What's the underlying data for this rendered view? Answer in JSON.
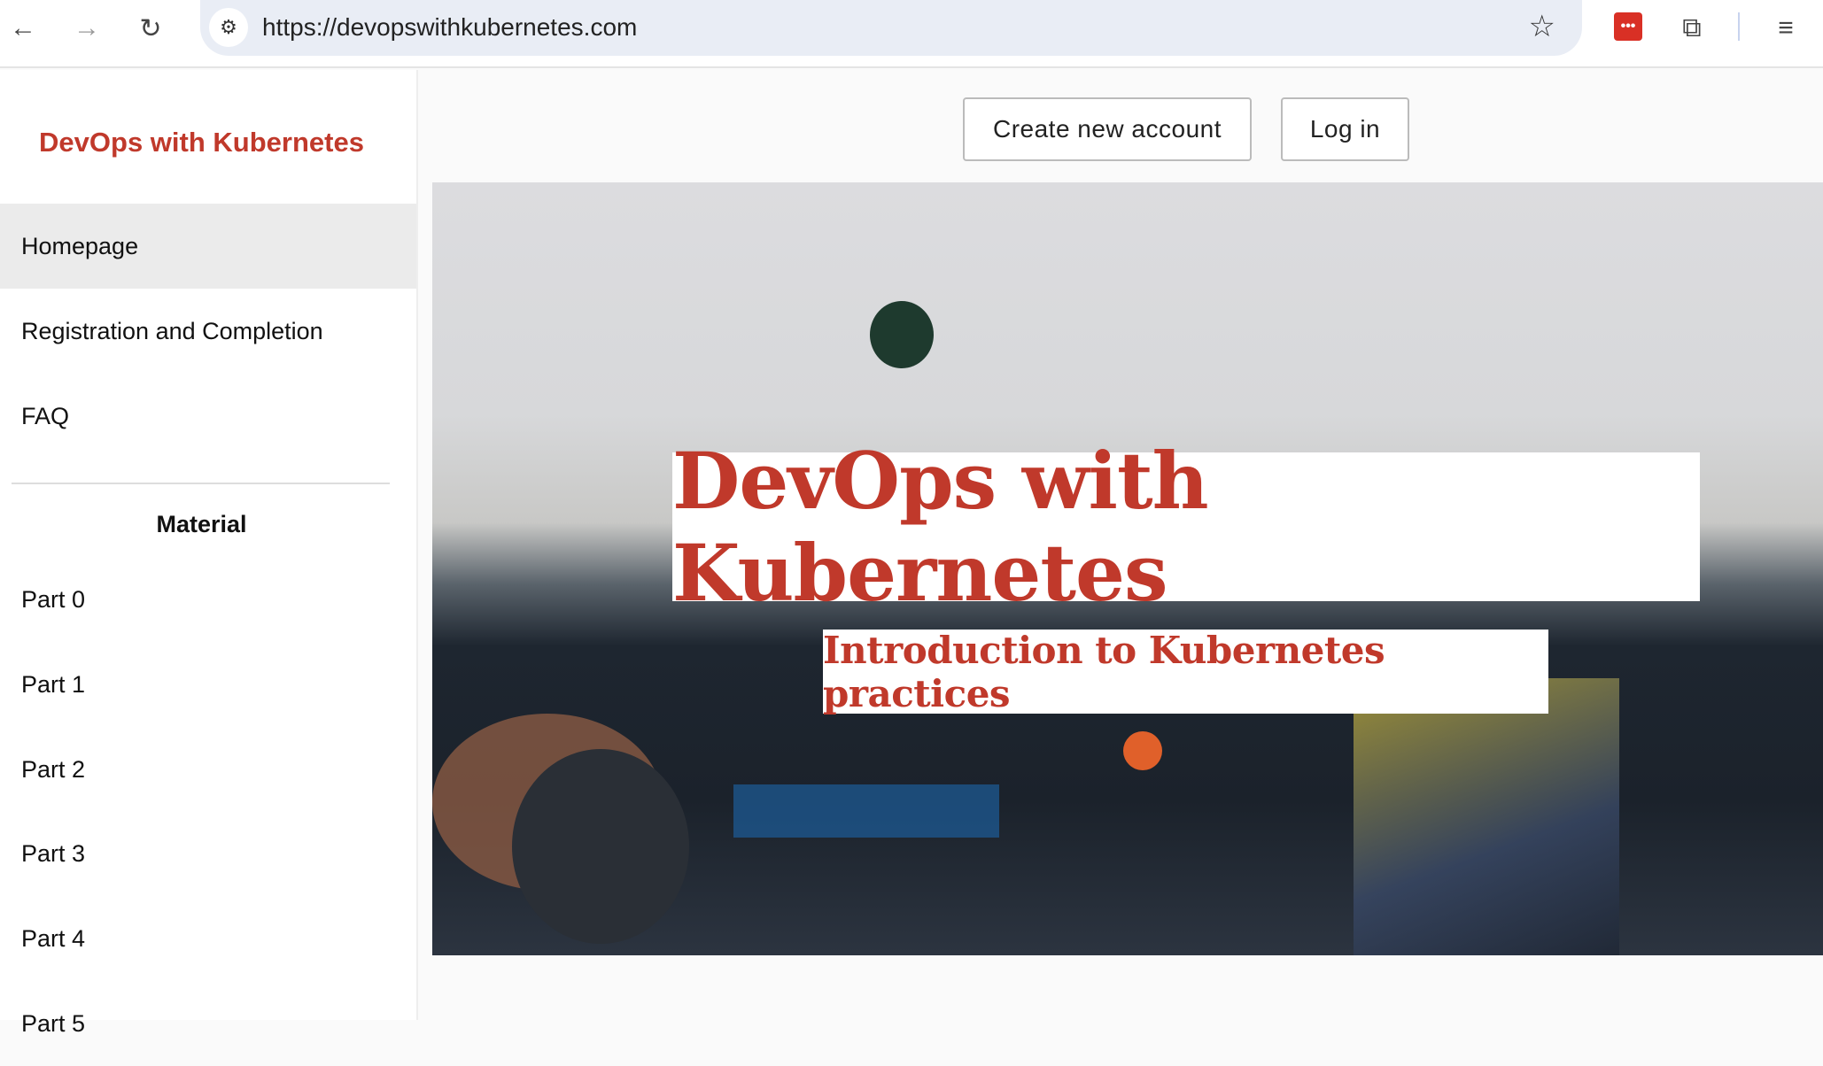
{
  "browser": {
    "url": "https://devopswithkubernetes.com"
  },
  "sidebar": {
    "brand": "DevOps with Kubernetes",
    "items": [
      {
        "label": "Homepage"
      },
      {
        "label": "Registration and Completion"
      },
      {
        "label": "FAQ"
      }
    ],
    "section_title": "Material",
    "parts": [
      {
        "label": "Part 0"
      },
      {
        "label": "Part 1"
      },
      {
        "label": "Part 2"
      },
      {
        "label": "Part 3"
      },
      {
        "label": "Part 4"
      },
      {
        "label": "Part 5"
      }
    ]
  },
  "header": {
    "create_account": "Create new account",
    "login": "Log in"
  },
  "hero": {
    "title": "DevOps with Kubernetes",
    "subtitle": "Introduction to Kubernetes practices"
  }
}
